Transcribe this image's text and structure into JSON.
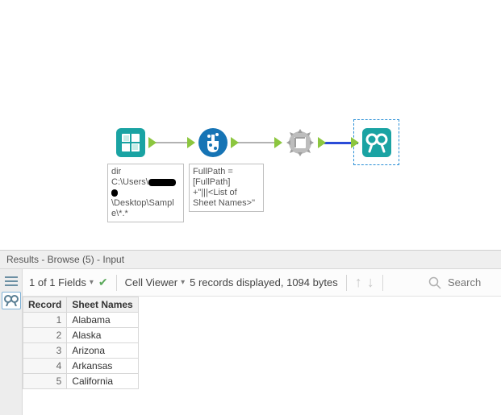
{
  "colors": {
    "teal": "#1aa3a3",
    "green": "#8cc63f",
    "gray": "#8a8a8a",
    "blue_wire": "#2a4bd7"
  },
  "workflow": {
    "tools": [
      {
        "id": "directory-tool",
        "note_lines": [
          "dir",
          "C:\\Users\\",
          "\\Desktop\\Sampl",
          "e\\*.*"
        ],
        "redacted_segment": true
      },
      {
        "id": "formula-tool",
        "note_lines": [
          "FullPath =",
          "[FullPath]",
          "+\"|||<List of",
          "Sheet Names>\""
        ]
      },
      {
        "id": "dynamic-input-tool"
      },
      {
        "id": "browse-tool"
      }
    ]
  },
  "results": {
    "header": "Results - Browse (5) - Input",
    "toolbar": {
      "fields_label": "1 of 1 Fields",
      "cellviewer_label": "Cell Viewer",
      "status": "5 records displayed, 1094 bytes",
      "search_placeholder": "Search"
    },
    "columns": {
      "record": "Record",
      "c1": "Sheet Names"
    },
    "rows": [
      {
        "n": "1",
        "v": "Alabama"
      },
      {
        "n": "2",
        "v": "Alaska"
      },
      {
        "n": "3",
        "v": "Arizona"
      },
      {
        "n": "4",
        "v": "Arkansas"
      },
      {
        "n": "5",
        "v": "California"
      }
    ]
  }
}
